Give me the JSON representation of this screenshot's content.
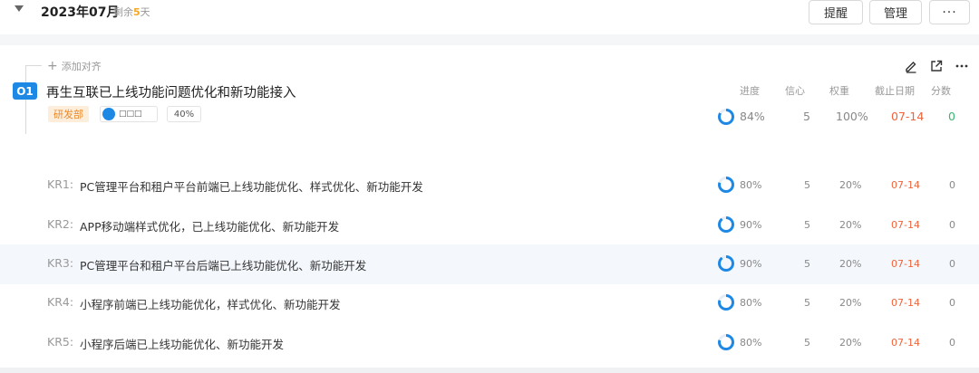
{
  "header": {
    "month": "2023年07月",
    "remain_prefix": "剩余",
    "remain_days": "5",
    "remain_suffix": "天",
    "remind_label": "提醒",
    "manage_label": "管理",
    "more_label": "···"
  },
  "objective": {
    "add_align_label": "添加对齐",
    "badge": "O1",
    "title": "再生互联已上线功能问题优化和新功能接入",
    "department": "研发部",
    "owner_name": "□□□",
    "weight_percent": "40%",
    "columns": {
      "progress": "进度",
      "confidence": "信心",
      "weight": "权重",
      "due": "截止日期",
      "score": "分数"
    },
    "progress": "84%",
    "progress_value": 0.84,
    "confidence": "5",
    "weight": "100%",
    "due": "07-14",
    "score": "0"
  },
  "key_results": [
    {
      "code": "KR1:",
      "text": "PC管理平台和租户平台前端已上线功能优化、样式优化、新功能开发",
      "progress": "80%",
      "progress_value": 0.8,
      "confidence": "5",
      "weight": "20%",
      "due": "07-14",
      "score": "0"
    },
    {
      "code": "KR2:",
      "text": "APP移动端样式优化，已上线功能优化、新功能开发",
      "progress": "90%",
      "progress_value": 0.9,
      "confidence": "5",
      "weight": "20%",
      "due": "07-14",
      "score": "0"
    },
    {
      "code": "KR3:",
      "text": "PC管理平台和租户平台后端已上线功能优化、新功能开发",
      "progress": "90%",
      "progress_value": 0.9,
      "confidence": "5",
      "weight": "20%",
      "due": "07-14",
      "score": "0"
    },
    {
      "code": "KR4:",
      "text": "小程序前端已上线功能优化，样式优化、新功能开发",
      "progress": "80%",
      "progress_value": 0.8,
      "confidence": "5",
      "weight": "20%",
      "due": "07-14",
      "score": "0"
    },
    {
      "code": "KR5:",
      "text": "小程序后端已上线功能优化、新功能开发",
      "progress": "80%",
      "progress_value": 0.8,
      "confidence": "5",
      "weight": "20%",
      "due": "07-14",
      "score": "0"
    }
  ],
  "colors": {
    "accent": "#1e88e5",
    "ring_track": "#e6eef8",
    "due": "#f0633a",
    "score": "#3cb371"
  }
}
